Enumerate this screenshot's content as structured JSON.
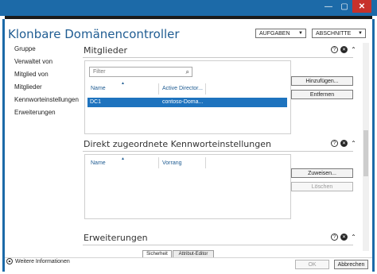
{
  "window": {
    "minimize_glyph": "—",
    "maximize_glyph": "▢",
    "close_glyph": "✕"
  },
  "header": {
    "title": "Klonbare Domänencontroller",
    "tasks_label": "AUFGABEN",
    "sections_label": "ABSCHNITTE"
  },
  "nav": {
    "items": [
      "Gruppe",
      "Verwaltet von",
      "Mitglied von",
      "Mitglieder",
      "Kennworteinstellungen",
      "Erweiterungen"
    ]
  },
  "members": {
    "title": "Mitglieder",
    "filter_placeholder": "Filter",
    "columns": [
      "Name",
      "Active Director..."
    ],
    "rows": [
      {
        "name": "DC1",
        "dn": "contoso-Doma..."
      }
    ],
    "add_button": "Hinzufügen...",
    "remove_button": "Entfernen"
  },
  "password_settings": {
    "title": "Direkt zugeordnete Kennworteinstellungen",
    "columns": [
      "Name",
      "Vorrang"
    ],
    "assign_button": "Zuweisen...",
    "delete_button": "Löschen"
  },
  "extensions": {
    "title": "Erweiterungen",
    "tabs": [
      "Sicherheit",
      "Attribut-Editor"
    ]
  },
  "footer": {
    "more_info": "Weitere Informationen",
    "ok_button": "OK",
    "cancel_button": "Abbrechen"
  },
  "colors": {
    "titlebar": "#1c6aa8",
    "close": "#c7312b",
    "selection": "#1e73be",
    "heading_blue": "#1f5c92"
  }
}
